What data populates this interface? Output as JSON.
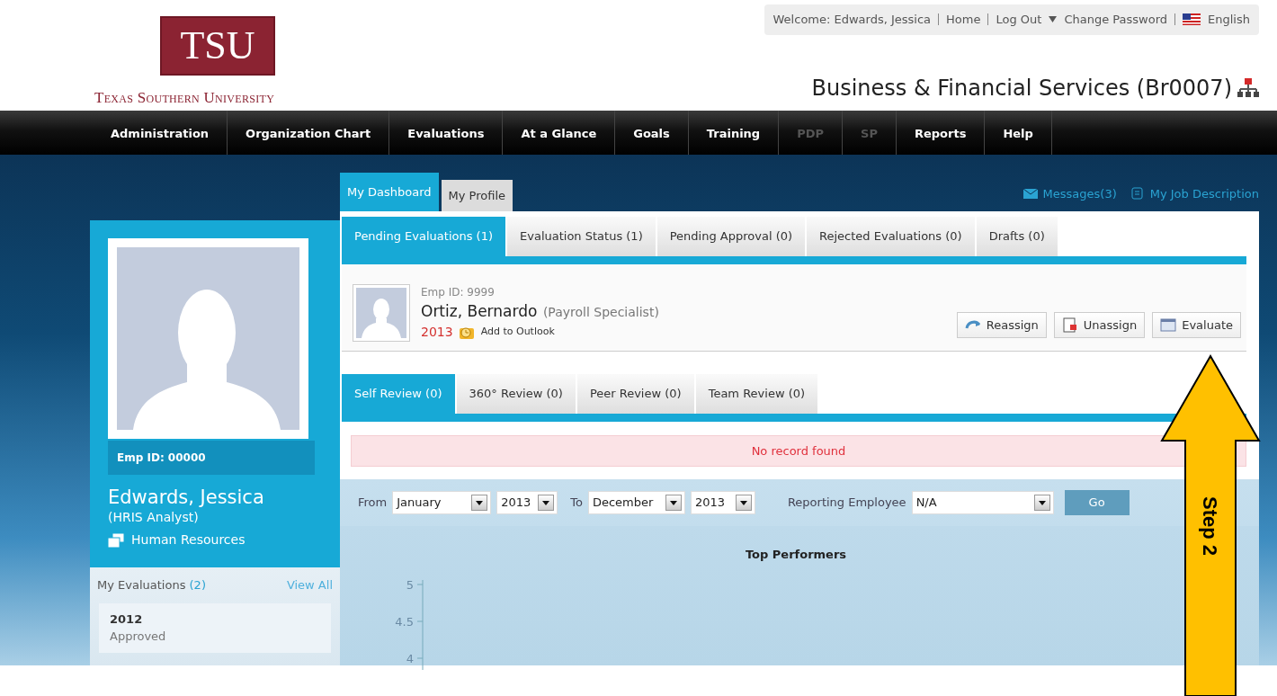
{
  "header": {
    "logo": "TSU",
    "university": "Texas Southern University",
    "top_links": [
      {
        "kind": "text",
        "label": "Welcome: Edwards, Jessica"
      },
      {
        "kind": "link",
        "label": "Home"
      },
      {
        "kind": "link",
        "label": "Log Out"
      },
      {
        "kind": "caret",
        "label": "Change Password"
      },
      {
        "kind": "flag",
        "label": "English"
      }
    ],
    "department": "Business & Financial Services (Br0007)"
  },
  "nav": [
    {
      "label": "Administration",
      "disabled": false
    },
    {
      "label": "Organization Chart",
      "disabled": false
    },
    {
      "label": "Evaluations",
      "disabled": false
    },
    {
      "label": "At a Glance",
      "disabled": false
    },
    {
      "label": "Goals",
      "disabled": false
    },
    {
      "label": "Training",
      "disabled": false
    },
    {
      "label": "PDP",
      "disabled": true
    },
    {
      "label": "SP",
      "disabled": true
    },
    {
      "label": "Reports",
      "disabled": false
    },
    {
      "label": "Help",
      "disabled": false
    }
  ],
  "profile": {
    "emp_id": "Emp ID: 00000",
    "name": "Edwards, Jessica",
    "title": "(HRIS Analyst)",
    "department": "Human Resources",
    "evaluations_label": "My Evaluations",
    "evaluations_count": "(2)",
    "view_all": "View All",
    "evaluations": [
      {
        "year": "2012",
        "status": "Approved"
      }
    ]
  },
  "main_tabs": [
    {
      "label": "My Dashboard",
      "selected": true
    },
    {
      "label": "My Profile",
      "selected": false
    }
  ],
  "quick_links": [
    {
      "kind": "mail",
      "label": "Messages(3)"
    },
    {
      "kind": "doc",
      "label": "My Job Description"
    }
  ],
  "sub_tabs": [
    {
      "label": "Pending Evaluations (1)",
      "selected": true
    },
    {
      "label": "Evaluation Status (1)",
      "selected": false
    },
    {
      "label": "Pending Approval (0)",
      "selected": false
    },
    {
      "label": "Rejected Evaluations (0)",
      "selected": false
    },
    {
      "label": "Drafts (0)",
      "selected": false
    }
  ],
  "employee": {
    "emp_id": "Emp ID: 9999",
    "name": "Ortiz, Bernardo",
    "title": "(Payroll Specialist)",
    "year": "2013",
    "outlook": "Add to Outlook",
    "actions": [
      {
        "kind": "reassign",
        "label": "Reassign"
      },
      {
        "kind": "unassign",
        "label": "Unassign"
      },
      {
        "kind": "evaluate",
        "label": "Evaluate"
      }
    ]
  },
  "review_tabs": [
    {
      "label": "Self Review (0)",
      "selected": true
    },
    {
      "label": "360° Review (0)",
      "selected": false
    },
    {
      "label": "Peer Review (0)",
      "selected": false
    },
    {
      "label": "Team Review (0)",
      "selected": false
    }
  ],
  "alert": "No record found",
  "filters": {
    "from_label": "From",
    "from_month": "January",
    "from_year": "2013",
    "to_label": "To",
    "to_month": "December",
    "to_year": "2013",
    "reporting_label": "Reporting Employee",
    "reporting_value": "N/A",
    "go": "Go"
  },
  "chart": {
    "title": "Top Performers",
    "y_axis_labels": [
      "5",
      "4.5",
      "4"
    ]
  },
  "annotation": {
    "label": "Step 2"
  }
}
